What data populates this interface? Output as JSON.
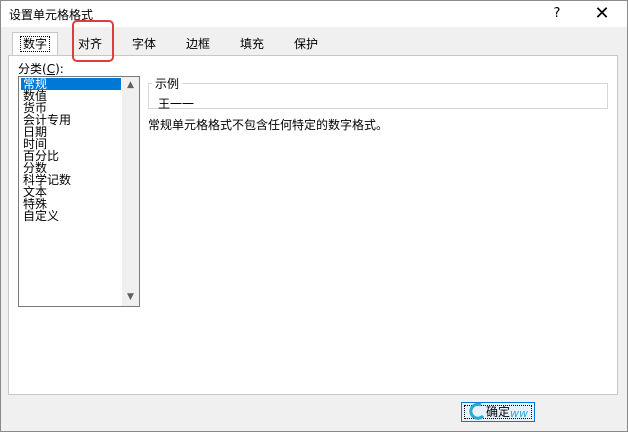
{
  "window": {
    "title": "设置单元格格式",
    "help": "?",
    "close": "✕"
  },
  "tabs": [
    {
      "label": "数字",
      "active": true
    },
    {
      "label": "对齐",
      "active": false
    },
    {
      "label": "字体",
      "active": false
    },
    {
      "label": "边框",
      "active": false
    },
    {
      "label": "填充",
      "active": false
    },
    {
      "label": "保护",
      "active": false
    }
  ],
  "category": {
    "label": "分类(",
    "accesskey": "C",
    "label_end": "):",
    "items": [
      "常规",
      "数值",
      "货币",
      "会计专用",
      "日期",
      "时间",
      "百分比",
      "分数",
      "科学记数",
      "文本",
      "特殊",
      "自定义"
    ],
    "selected": "常规"
  },
  "sample": {
    "legend": "示例",
    "value": "王一一"
  },
  "description": "常规单元格格式不包含任何特定的数字格式。",
  "buttons": {
    "ok": "确定"
  },
  "watermark": {
    "text": "ww"
  },
  "colors": {
    "highlight": "#e23b3b",
    "selection": "#0078d7"
  }
}
